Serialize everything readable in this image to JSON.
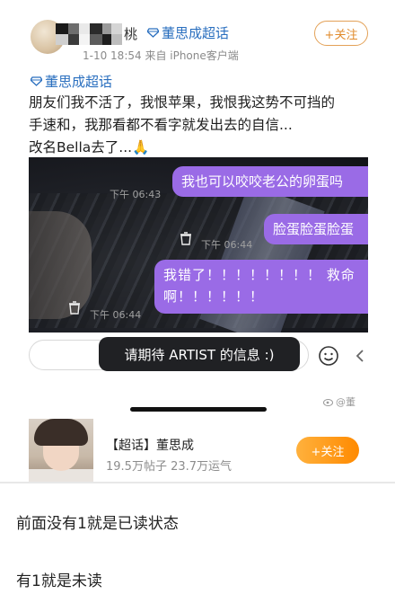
{
  "post": {
    "author_name_tail": "桃",
    "author_chaohua": "董思成超话",
    "meta": "1-10 18:54  来自 iPhone客户端",
    "follow_label": "+关注",
    "topic": "董思成超话",
    "body_lines": [
      "朋友们我不活了，我恨苹果，我恨我这势不可挡的",
      "手速和，我那看都不看字就发出去的自信...",
      "改名Bella去了...🙏"
    ]
  },
  "chat": {
    "messages": [
      {
        "text": "我也可以咬咬老公的卵蛋吗",
        "time": "下午 06:43"
      },
      {
        "text": "脸蛋脸蛋脸蛋",
        "time": "下午 06:44"
      },
      {
        "text": "我错了！！！！！！！！ 救命啊！！！！！！",
        "time": "下午 06:44"
      }
    ],
    "toast": "请期待 ARTIST 的信息 :)",
    "watermark": "@董"
  },
  "card": {
    "title": "【超话】董思成",
    "stats": "19.5万帖子  23.7万运气",
    "follow_label": "+关注"
  },
  "captions": {
    "line1": "前面没有1就是已读状态",
    "line2": "有1就是未读"
  },
  "colors": {
    "link_blue": "#2a6fbf",
    "bubble_purple": "#9a6be6",
    "follow_orange": "#ff8a00"
  }
}
